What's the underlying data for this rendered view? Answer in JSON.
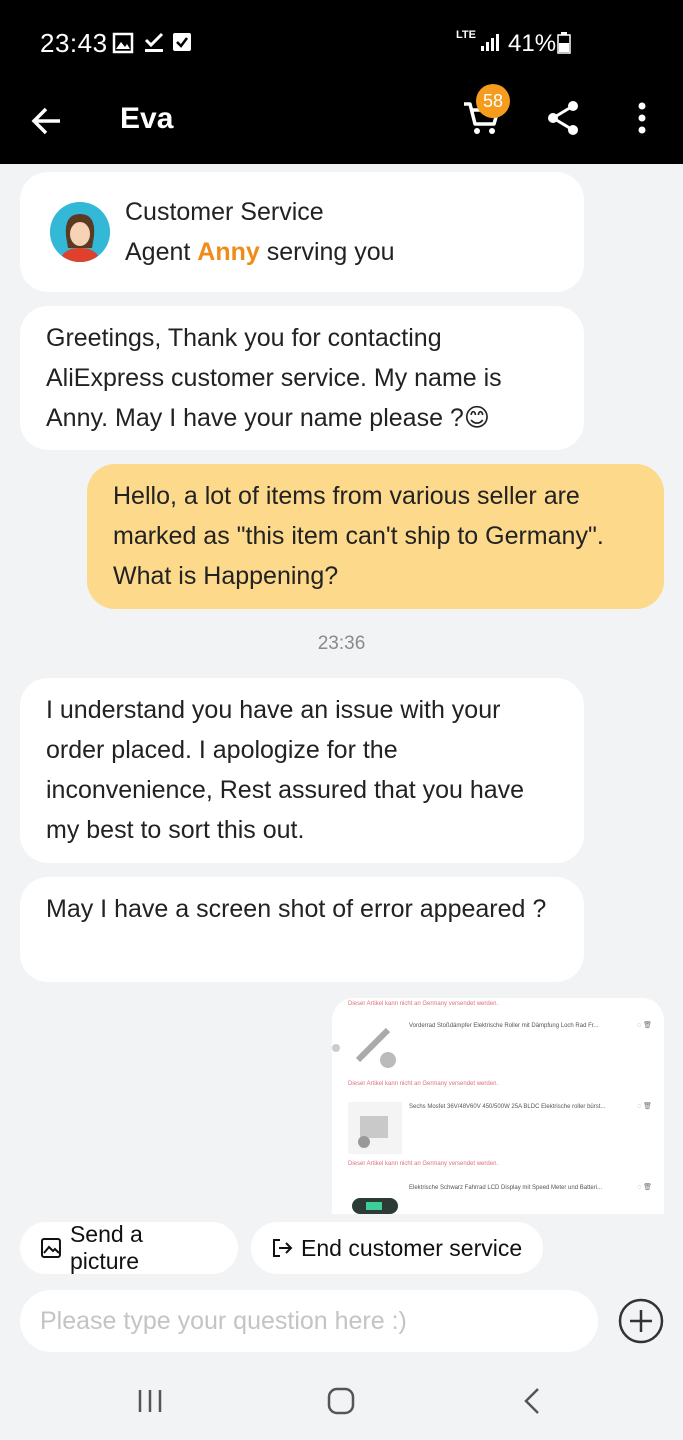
{
  "status_bar": {
    "time": "23:43",
    "network": "LTE",
    "battery": "41%"
  },
  "app_bar": {
    "title": "Eva",
    "cart_badge": "58"
  },
  "agent_card": {
    "line1": "Customer Service",
    "line2_prefix": "Agent ",
    "agent_name": "Anny",
    "line2_suffix": " serving you"
  },
  "messages": [
    {
      "sender": "agent",
      "text": " Greetings, Thank you for contacting AliExpress customer service. My name is Anny. May I have your name please ?😊"
    },
    {
      "sender": "user",
      "text": "Hello, a lot of items from various seller are marked as \"this item can't ship to Germany\". What is Happening?"
    },
    {
      "sender": "agent",
      "text": "I understand you have an issue with your order  placed. I apologize for the inconvenience, Rest assured that you have my best to sort this out."
    },
    {
      "sender": "agent",
      "text": "May I  have a screen shot of error appeared ?"
    }
  ],
  "timestamp": "23:36",
  "screenshot_message": {
    "warning": "Dieser Artikel kann nicht an Germany versendet werden.",
    "items": [
      "Vorderrad Stoßdämpfer Elektrische Roller mit Dämpfung Loch Rad Fr...",
      "Sechs Mosfet 36V/48V60V 450/500W 25A BLDC Elektrische roller bürst...",
      "Elektrische Schwarz Fahrrad LCD Display mit Speed Meter und Batteri..."
    ]
  },
  "actions": {
    "send_picture": "Send a picture",
    "end_service": "End customer service"
  },
  "input": {
    "placeholder": "Please type your question here :)"
  },
  "colors": {
    "accent": "#f08a19",
    "badge": "#f59b1e",
    "user_bubble": "#fcd98b",
    "background": "#f2f3f5"
  }
}
